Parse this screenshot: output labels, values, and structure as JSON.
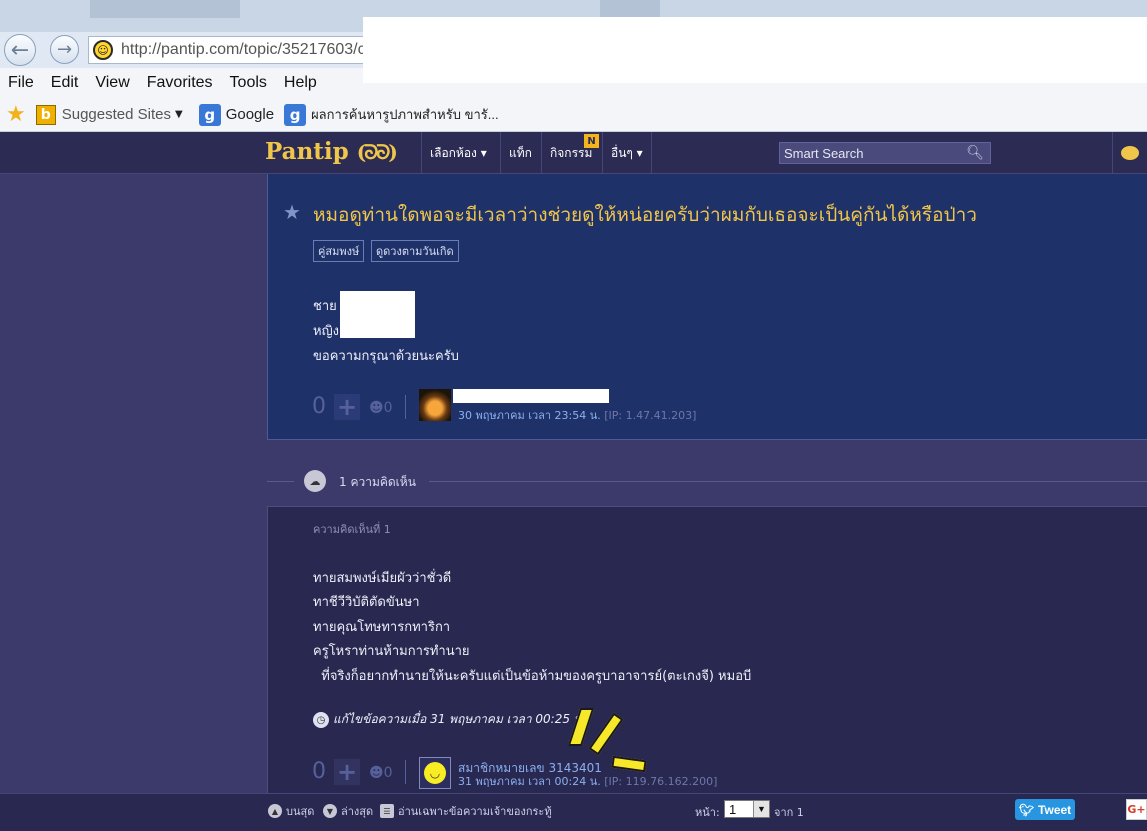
{
  "browser": {
    "address_url": "http://pantip.com/topic/35217603/c",
    "menu": [
      "File",
      "Edit",
      "View",
      "Favorites",
      "Tools",
      "Help"
    ],
    "favorites": {
      "suggested_sites": "Suggested Sites",
      "google": "Google",
      "thai_link": "ผลการค้นหารูปภาพสำหรับ ขารั..."
    }
  },
  "site_nav": {
    "logo": "Pantip",
    "logo_mark": "(ᘐᘐ)",
    "items": [
      "เลือกห้อง ▾",
      "แท็ก",
      "กิจกรรม",
      "อื่นๆ ▾"
    ],
    "new_badge": "N",
    "search_placeholder": "Smart Search"
  },
  "topic": {
    "title": "หมอดูท่านใดพอจะมีเวลาว่างช่วยดูให้หน่อยครับว่าผมกับเธอจะเป็นคู่กันได้หรือป่าว",
    "tags": [
      "คู่สมพงษ์",
      "ดูดวงตามวันเกิด"
    ],
    "body": [
      "ชาย",
      "หญิง",
      "ขอความกรุณาด้วยนะครับ"
    ],
    "votes": "0",
    "emotion_count": "0",
    "date": "30 พฤษภาคม เวลา 23:54 น.",
    "ip": "[IP: 1.47.41.203]"
  },
  "comments_header": "1 ความคิดเห็น",
  "comment": {
    "label": "ความคิดเห็นที่ 1",
    "lines": [
      "ทายสมพงษ์เมียผัวว่าชั่วดี",
      "ทาชีวีวิบัติตัดขันษา",
      "ทายคุณโทษทารกทาริกา",
      "ครูโหราท่านห้ามการทำนาย",
      "  ที่จริงก็อยากทำนายให้นะครับแต่เป็นข้อห้ามของครูบาอาจารย์(ตะเกงจี) หมอบี"
    ],
    "edit_note": "แก้ไขข้อความเมื่อ 31 พฤษภาคม เวลา 00:25 น.",
    "member": "สมาชิกหมายเลข 3143401",
    "date": "31 พฤษภาคม เวลา 00:24 น.",
    "ip": "[IP: 119.76.162.200]",
    "votes": "0",
    "emotion_count": "0"
  },
  "bottom_bar": {
    "top": "บนสุด",
    "bottom": "ล่างสุด",
    "owner_only": "อ่านเฉพาะข้อความเจ้าของกระทู้",
    "page_label": "หน้า:",
    "page_value": "1",
    "of_label": "จาก 1",
    "tweet": "Tweet",
    "gplus": "G+"
  }
}
